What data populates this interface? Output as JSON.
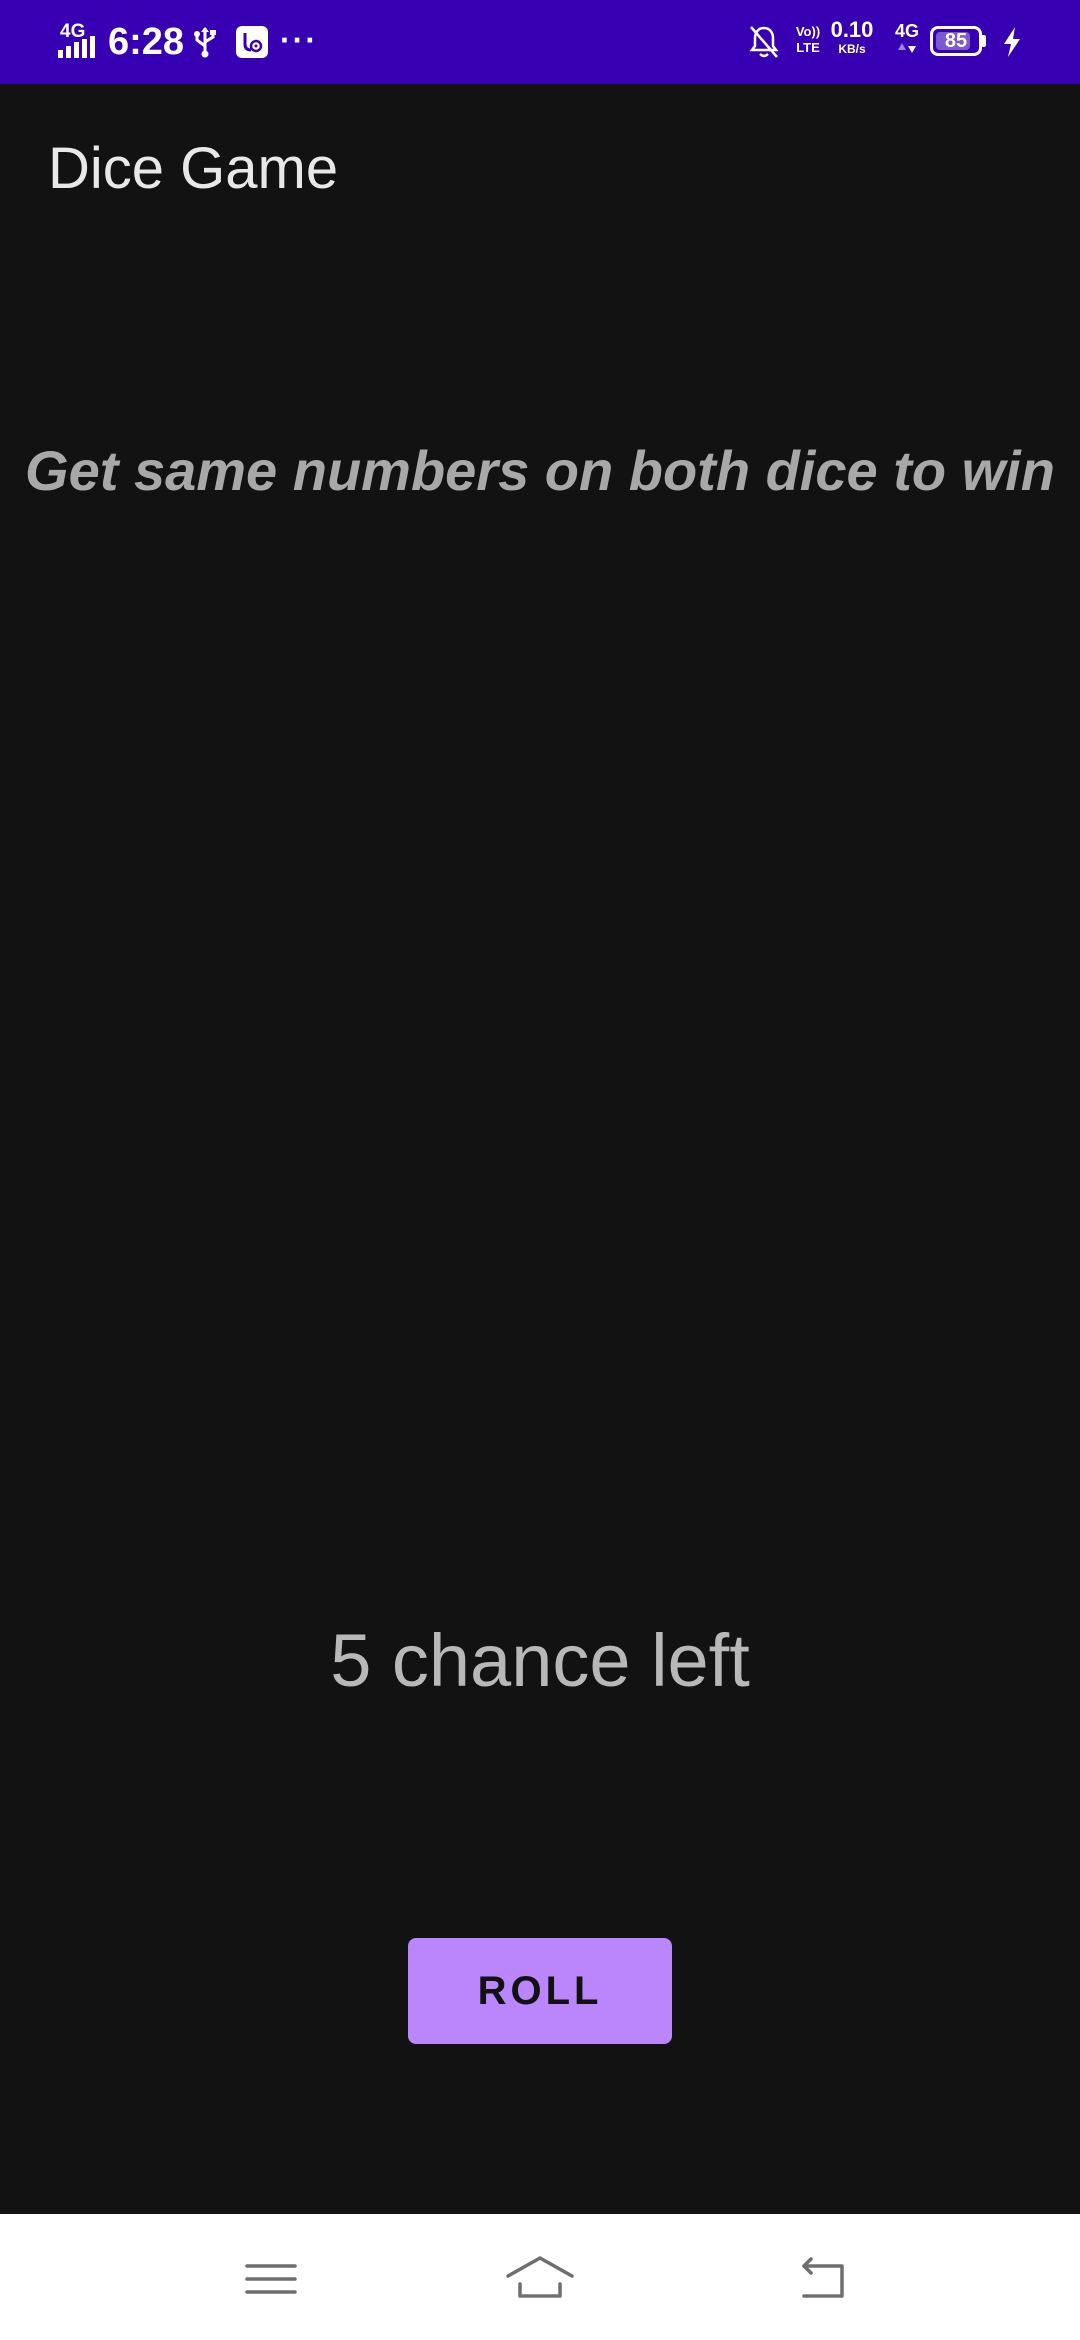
{
  "status_bar": {
    "network_type": "4G",
    "time": "6:28",
    "more_indicator": "···",
    "volte_top": "Vo))",
    "volte_bottom": "LTE",
    "speed_value": "0.10",
    "speed_unit": "KB/s",
    "data_network": "4G",
    "battery_level": "85",
    "battery_fraction": 0.85,
    "icons": [
      "signal-icon",
      "usb-icon",
      "app-badge-icon",
      "notifications-muted-icon",
      "volte-icon",
      "data-arrows-icon",
      "battery-icon",
      "charging-icon"
    ],
    "background_color": "#3700b3"
  },
  "app_bar": {
    "title": "Dice Game"
  },
  "main": {
    "instruction": "Get same numbers on both dice to win",
    "chances_text": "5 chance left",
    "roll_button_label": "ROLL",
    "accent_color": "#bb86fc",
    "background_color": "#121212"
  },
  "nav_bar": {
    "icons": [
      "menu-icon",
      "home-icon",
      "back-icon"
    ]
  }
}
